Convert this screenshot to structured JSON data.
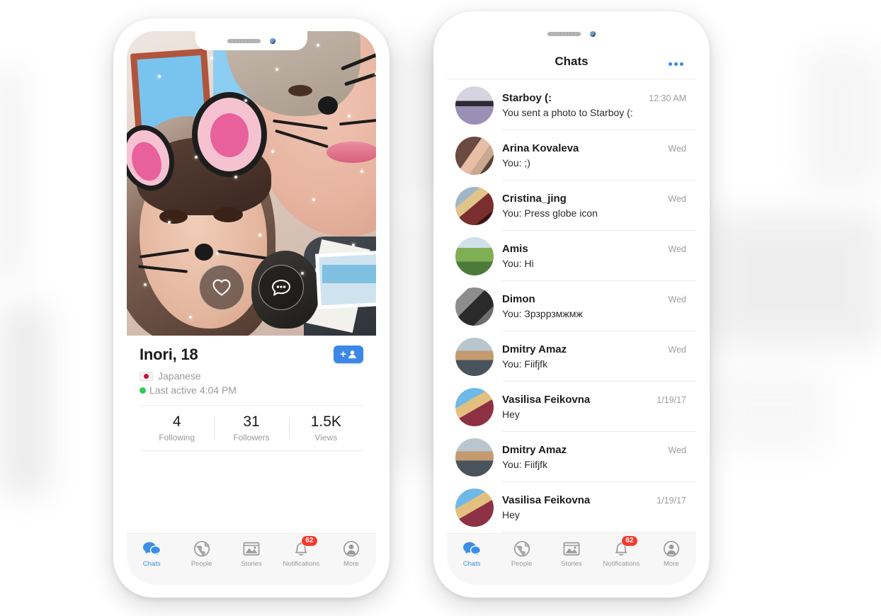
{
  "app": {
    "accent_blue": "#3b8fe8",
    "badge_red": "#f5392c",
    "online_green": "#2ecc58"
  },
  "left_phone": {
    "screen_name": "profile-screen",
    "photo": {
      "description": "selfie-with-animal-face-filter",
      "actions": [
        {
          "name": "like-button",
          "icon": "heart-icon"
        },
        {
          "name": "message-button",
          "icon": "speech-bubble-icon"
        }
      ]
    },
    "profile": {
      "name": "Inori, 18",
      "add_friend_label": "+",
      "add_friend_icon": "add-person-icon",
      "language_flag": "japan-flag-icon",
      "language": "Japanese",
      "status": "Last active 4:04 PM",
      "stats": [
        {
          "value": "4",
          "label": "Following"
        },
        {
          "value": "31",
          "label": "Followers"
        },
        {
          "value": "1.5K",
          "label": "Views"
        }
      ]
    },
    "tabbar": {
      "tabs": [
        {
          "label": "Chats",
          "icon": "chat-bubbles-icon",
          "active": true,
          "badge": ""
        },
        {
          "label": "People",
          "icon": "globe-icon",
          "active": false,
          "badge": ""
        },
        {
          "label": "Stories",
          "icon": "photo-icon",
          "active": false,
          "badge": ""
        },
        {
          "label": "Notifications",
          "icon": "bell-icon",
          "active": false,
          "badge": "62"
        },
        {
          "label": "More",
          "icon": "person-icon",
          "active": false,
          "badge": ""
        }
      ]
    }
  },
  "right_phone": {
    "screen_name": "chats-screen",
    "nav": {
      "title": "Chats",
      "more_icon": "three-dots-icon"
    },
    "chats": [
      {
        "name": "Starboy (:",
        "snippet": "You sent a photo to Starboy (:",
        "time": "12:30 AM",
        "avatar": "avatar-lavender-field"
      },
      {
        "name": "Arina Kovaleva",
        "snippet": "You: ;)",
        "time": "Wed",
        "avatar": "avatar-girl-glasses"
      },
      {
        "name": "Cristina_jing",
        "snippet": "You: Press globe icon",
        "time": "Wed",
        "avatar": "avatar-dark-indoor"
      },
      {
        "name": "Amis",
        "snippet": "You: Hi",
        "time": "Wed",
        "avatar": "avatar-cyclist-grass"
      },
      {
        "name": "Dimon",
        "snippet": "You: Зрзррзмжмж",
        "time": "Wed",
        "avatar": "avatar-black-white"
      },
      {
        "name": "Dmitry Amaz",
        "snippet": "You: Fiifjfk",
        "time": "Wed",
        "avatar": "avatar-bearded-man"
      },
      {
        "name": "Vasilisa Feikovna",
        "snippet": "Hey",
        "time": "1/19/17",
        "avatar": "avatar-blonde-cap-sky"
      },
      {
        "name": "Dmitry Amaz",
        "snippet": "You: Fiifjfk",
        "time": "Wed",
        "avatar": "avatar-bearded-man"
      },
      {
        "name": "Vasilisa Feikovna",
        "snippet": "Hey",
        "time": "1/19/17",
        "avatar": "avatar-blonde-cap-sky"
      }
    ],
    "tabbar": {
      "tabs": [
        {
          "label": "Chats",
          "icon": "chat-bubbles-icon",
          "active": true,
          "badge": ""
        },
        {
          "label": "People",
          "icon": "globe-icon",
          "active": false,
          "badge": ""
        },
        {
          "label": "Stories",
          "icon": "photo-icon",
          "active": false,
          "badge": ""
        },
        {
          "label": "Notifications",
          "icon": "bell-icon",
          "active": false,
          "badge": "62"
        },
        {
          "label": "More",
          "icon": "person-icon",
          "active": false,
          "badge": ""
        }
      ]
    }
  }
}
